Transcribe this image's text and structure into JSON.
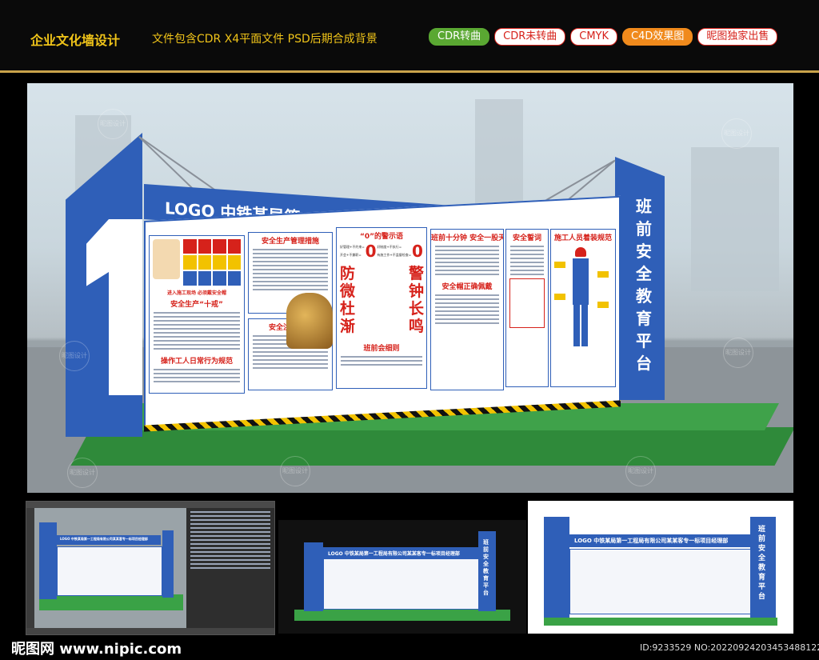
{
  "header": {
    "title": "企业文化墙设计",
    "description": "文件包含CDR X4平面文件   PSD后期合成背景",
    "tags": [
      {
        "label": "CDR转曲",
        "bg": "#5aa832",
        "color": "#ffffff",
        "border": "#5aa832"
      },
      {
        "label": "CDR未转曲",
        "bg": "#ffffff",
        "color": "#d6221b",
        "border": "#d6221b"
      },
      {
        "label": "CMYK",
        "bg": "#ffffff",
        "color": "#d6221b",
        "border": "#d6221b"
      },
      {
        "label": "C4D效果图",
        "bg": "#f08a1c",
        "color": "#ffffff",
        "border": "#f08a1c"
      },
      {
        "label": "昵图独家出售",
        "bg": "#ffffff",
        "color": "#d6221b",
        "border": "#d6221b"
      }
    ]
  },
  "scene": {
    "banner": "LOGO 中铁某局第一工程局有限公司某某客专一标项目经理部",
    "pillar_text": "班前安全教育平台",
    "panels": {
      "ten_rules": "安全生产“十戒”",
      "entry_sign": "进入施工现场 必须戴安全帽",
      "daily_norms": "操作工人日常行为规范",
      "management": "安全生产管理措施",
      "attention": "安全注意事项",
      "warning_title": "“0”的警示语",
      "warning_left": "防微杜渐",
      "warning_right": "警钟长鸣",
      "meeting_rules": "班前会细则",
      "ten_minutes": "班前十分钟  安全一股天",
      "helmet": "安全帽正确佩戴",
      "oath": "安全誓词",
      "dress_code": "施工人员着装规范",
      "zero": "0",
      "zero_left_top": "好管理+不约束=",
      "zero_left_bottom": "开会+不兼职=",
      "zero_right_top": "好制度+不执行=",
      "zero_right_bottom": "有施工作+不监督检查="
    }
  },
  "colors": {
    "brand_blue": "#2f5fb8",
    "accent_red": "#d6221b",
    "header_gold": "#f0c419",
    "grass_green": "#3fa24a"
  },
  "watermark": "昵图设计",
  "footer": {
    "logo": "昵图网 www.nipic.com",
    "id": "ID:9233529 NO:20220924203453488122"
  },
  "thumbnails": {
    "banner_short": "LOGO 中铁某局第一工程局有限公司某某客专一标项目经理部",
    "pillar_short": "班前安全教育平台"
  }
}
